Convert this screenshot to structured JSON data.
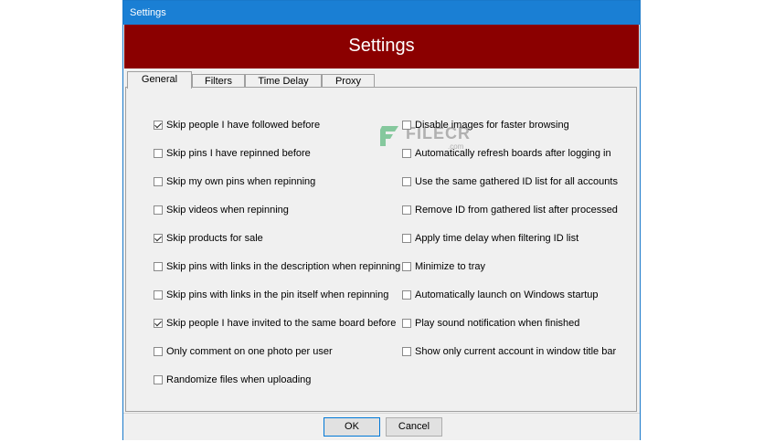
{
  "window": {
    "title": "Settings"
  },
  "banner": {
    "title": "Settings"
  },
  "tabs": [
    {
      "label": "General",
      "active": true
    },
    {
      "label": "Filters",
      "active": false
    },
    {
      "label": "Time Delay",
      "active": false
    },
    {
      "label": "Proxy",
      "active": false
    }
  ],
  "left_options": [
    {
      "label": "Skip people I have followed before",
      "checked": true
    },
    {
      "label": "Skip pins I have repinned before",
      "checked": false
    },
    {
      "label": "Skip my own pins when repinning",
      "checked": false
    },
    {
      "label": "Skip videos when repinning",
      "checked": false
    },
    {
      "label": "Skip products for sale",
      "checked": true
    },
    {
      "label": "Skip pins with links in the description when repinning",
      "checked": false
    },
    {
      "label": "Skip pins with links in the pin itself when repinning",
      "checked": false
    },
    {
      "label": "Skip people I have invited to the same board before",
      "checked": true
    },
    {
      "label": "Only comment on one photo per user",
      "checked": false
    },
    {
      "label": "Randomize files when uploading",
      "checked": false
    }
  ],
  "right_options": [
    {
      "label": "Disable images for faster browsing",
      "checked": false
    },
    {
      "label": "Automatically refresh boards after logging in",
      "checked": false
    },
    {
      "label": "Use the same gathered ID list for all accounts",
      "checked": false
    },
    {
      "label": "Remove ID from gathered list after processed",
      "checked": false
    },
    {
      "label": "Apply time delay when filtering ID list",
      "checked": false
    },
    {
      "label": "Minimize to tray",
      "checked": false
    },
    {
      "label": "Automatically launch on Windows startup",
      "checked": false
    },
    {
      "label": "Play sound notification when finished",
      "checked": false
    },
    {
      "label": "Show only current account in window title bar",
      "checked": false
    }
  ],
  "buttons": {
    "ok": "OK",
    "cancel": "Cancel"
  },
  "watermark": {
    "text": "FILECR",
    "sub": ".com"
  },
  "colors": {
    "banner": "#8b0000",
    "titlebar": "#1a7fd4"
  }
}
